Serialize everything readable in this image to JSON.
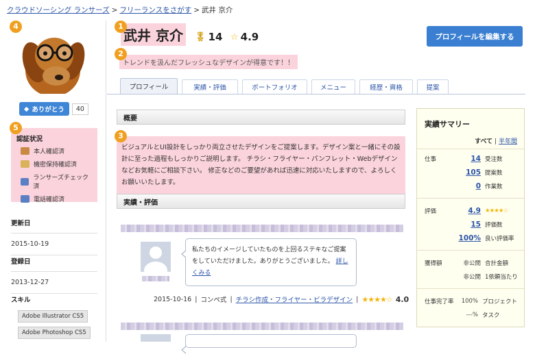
{
  "breadcrumb": {
    "items": [
      "クラウドソーシング ランサーズ",
      "フリーランスをさがす"
    ],
    "current": "武井 京介",
    "separator": ">"
  },
  "markers": [
    "1",
    "2",
    "3",
    "4",
    "5"
  ],
  "profile": {
    "name": "武井 京介",
    "badge_count": "14",
    "rating": "4.9",
    "tagline": "トレンドを汲んだフレッシュなデザインが得意です！！",
    "edit_button": "プロフィールを編集する"
  },
  "thanks": {
    "label": "ありがとう",
    "count": "40"
  },
  "verification": {
    "title": "認証状況",
    "items": [
      "本人確認済",
      "機密保持確認済",
      "ランサーズチェック済",
      "電話確認済"
    ]
  },
  "sidebar": {
    "updated_label": "更新日",
    "updated_value": "2015-10-19",
    "registered_label": "登録日",
    "registered_value": "2013-12-27",
    "skills_label": "スキル",
    "skills": [
      "Adobe Illustrator CS5",
      "Adobe Photoshop CS5"
    ]
  },
  "tabs": [
    "プロフィール",
    "実績・評価",
    "ポートフォリオ",
    "メニュー",
    "経歴・資格",
    "提案"
  ],
  "overview": {
    "heading": "概要",
    "text": "ビジュアルとUI設計をしっかり両立させたデザインをご提案します。デザイン案と一緒にその設計に至った過程もしっかりご説明します。 チラシ・フライヤー・パンフレット・Webデザインなどお気軽にご相談下さい。 修正などのご要望があれば迅速に対応いたしますので、よろしくお願いいたします。"
  },
  "reviews": {
    "heading": "実績・評価",
    "items": [
      {
        "comment": "私たちのイメージしていたものを上回るステキなご提案をしていただけました。ありがとうございました。",
        "more": "詳しくみる",
        "date": "2015-10-16",
        "type": "コンペ式",
        "category": "チラシ作成・フライヤー・ビラデザイン",
        "stars": "★★★★☆",
        "score": "4.0"
      }
    ]
  },
  "summary": {
    "title": "実績サマリー",
    "filter_all": "すべて",
    "filter_sep": "|",
    "filter_half": "半年間",
    "work_label": "仕事",
    "rows": [
      {
        "value": "14",
        "label": "受注数"
      },
      {
        "value": "105",
        "label": "提案数"
      },
      {
        "value": "0",
        "label": "作業数"
      }
    ],
    "eval_label": "評価",
    "eval_value": "4.9",
    "eval_stars": "★★★★☆",
    "eval_count": "15",
    "eval_count_label": "評価数",
    "good_rate": "100%",
    "good_rate_label": "良い評価率",
    "earn_label": "獲得額",
    "earn_total_value": "非公開",
    "earn_total_label": "合計金額",
    "earn_per_value": "非公開",
    "earn_per_label": "1依頼当たり",
    "complete_label": "仕事完了率",
    "complete_project_value": "100%",
    "complete_project_label": "プロジェクト",
    "complete_task_value": "---%",
    "complete_task_label": "タスク"
  },
  "colors": {
    "accent_blue": "#3a7fd1",
    "highlight_pink": "#fbd3dc",
    "marker_orange": "#f0a020",
    "star_gold": "#f2b50c"
  }
}
